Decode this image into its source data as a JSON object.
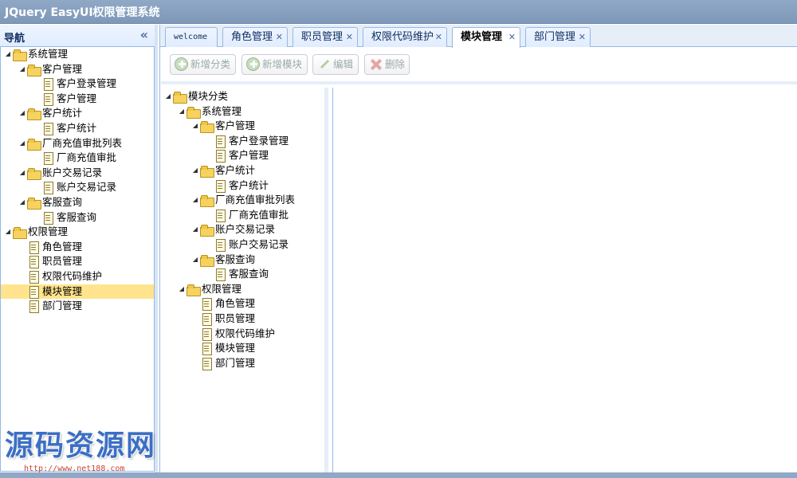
{
  "app": {
    "title": "JQuery EasyUI权限管理系统"
  },
  "nav": {
    "title": "导航",
    "tree": [
      {
        "label": "系统管理",
        "type": "folder",
        "level": 0,
        "expanded": true
      },
      {
        "label": "客户管理",
        "type": "folder",
        "level": 1,
        "expanded": true
      },
      {
        "label": "客户登录管理",
        "type": "file",
        "level": 2
      },
      {
        "label": "客户管理",
        "type": "file",
        "level": 2
      },
      {
        "label": "客户统计",
        "type": "folder",
        "level": 1,
        "expanded": true
      },
      {
        "label": "客户统计",
        "type": "file",
        "level": 2
      },
      {
        "label": "厂商充值审批列表",
        "type": "folder",
        "level": 1,
        "expanded": true
      },
      {
        "label": "厂商充值审批",
        "type": "file",
        "level": 2
      },
      {
        "label": "账户交易记录",
        "type": "folder",
        "level": 1,
        "expanded": true
      },
      {
        "label": "账户交易记录",
        "type": "file",
        "level": 2
      },
      {
        "label": "客服查询",
        "type": "folder",
        "level": 1,
        "expanded": true
      },
      {
        "label": "客服查询",
        "type": "file",
        "level": 2
      },
      {
        "label": "权限管理",
        "type": "folder",
        "level": 0,
        "expanded": true
      },
      {
        "label": "角色管理",
        "type": "file",
        "level": 1
      },
      {
        "label": "职员管理",
        "type": "file",
        "level": 1
      },
      {
        "label": "权限代码维护",
        "type": "file",
        "level": 1
      },
      {
        "label": "模块管理",
        "type": "file",
        "level": 1,
        "selected": true
      },
      {
        "label": "部门管理",
        "type": "file",
        "level": 1
      }
    ]
  },
  "tabs": [
    {
      "label": "welcome",
      "closable": false,
      "active": false
    },
    {
      "label": "角色管理",
      "closable": true,
      "active": false
    },
    {
      "label": "职员管理",
      "closable": true,
      "active": false
    },
    {
      "label": "权限代码维护",
      "closable": true,
      "active": false
    },
    {
      "label": "模块管理",
      "closable": true,
      "active": true
    },
    {
      "label": "部门管理",
      "closable": true,
      "active": false
    }
  ],
  "toolbar": {
    "add_category": "新增分类",
    "add_module": "新增模块",
    "edit": "编辑",
    "delete": "删除"
  },
  "module_tree": [
    {
      "label": "模块分类",
      "type": "folder",
      "level": 0,
      "expanded": true
    },
    {
      "label": "系统管理",
      "type": "folder",
      "level": 1,
      "expanded": true
    },
    {
      "label": "客户管理",
      "type": "folder",
      "level": 2,
      "expanded": true
    },
    {
      "label": "客户登录管理",
      "type": "file",
      "level": 3
    },
    {
      "label": "客户管理",
      "type": "file",
      "level": 3
    },
    {
      "label": "客户统计",
      "type": "folder",
      "level": 2,
      "expanded": true
    },
    {
      "label": "客户统计",
      "type": "file",
      "level": 3
    },
    {
      "label": "厂商充值审批列表",
      "type": "folder",
      "level": 2,
      "expanded": true
    },
    {
      "label": "厂商充值审批",
      "type": "file",
      "level": 3
    },
    {
      "label": "账户交易记录",
      "type": "folder",
      "level": 2,
      "expanded": true
    },
    {
      "label": "账户交易记录",
      "type": "file",
      "level": 3
    },
    {
      "label": "客服查询",
      "type": "folder",
      "level": 2,
      "expanded": true
    },
    {
      "label": "客服查询",
      "type": "file",
      "level": 3
    },
    {
      "label": "权限管理",
      "type": "folder",
      "level": 1,
      "expanded": true
    },
    {
      "label": "角色管理",
      "type": "file",
      "level": 2
    },
    {
      "label": "职员管理",
      "type": "file",
      "level": 2
    },
    {
      "label": "权限代码维护",
      "type": "file",
      "level": 2
    },
    {
      "label": "模块管理",
      "type": "file",
      "level": 2
    },
    {
      "label": "部门管理",
      "type": "file",
      "level": 2
    }
  ],
  "watermark": {
    "text": "源码资源网",
    "url": "http://www.net188.com"
  }
}
